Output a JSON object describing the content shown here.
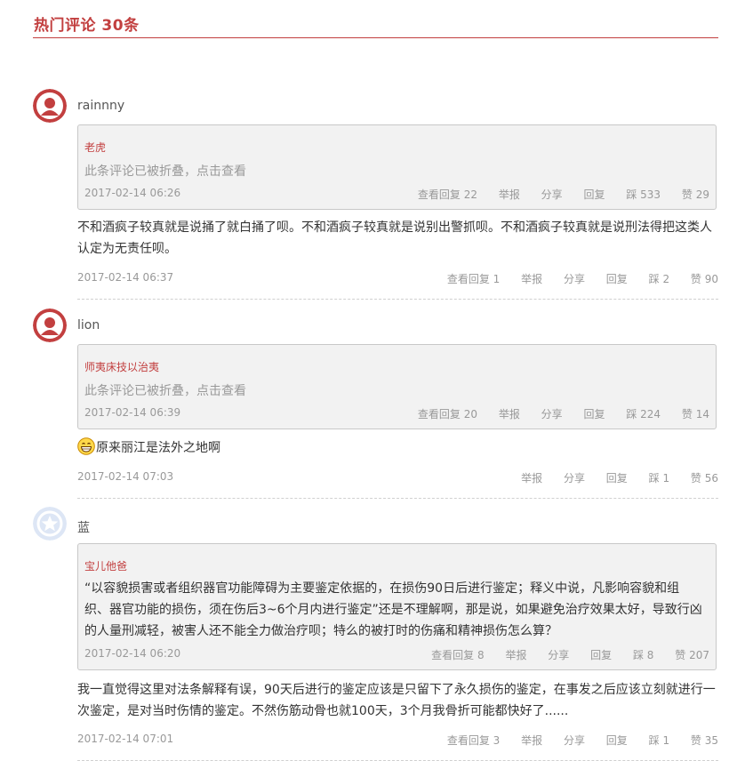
{
  "header": {
    "title": "热门评论 30条"
  },
  "comments": [
    {
      "user": "rainnny",
      "quote": {
        "user": "老虎",
        "folded": "此条评论已被折叠，点击查看",
        "time": "2017-02-14 06:26",
        "view_replies": "查看回复 22",
        "report": "举报",
        "share": "分享",
        "reply": "回复",
        "dislike": "踩 533",
        "like": "赞 29"
      },
      "text": "不和酒疯子较真就是说捅了就白捅了呗。不和酒疯子较真就是说别出警抓呗。不和酒疯子较真就是说刑法得把这类人认定为无责任呗。",
      "time": "2017-02-14 06:37",
      "view_replies": "查看回复 1",
      "report": "举报",
      "share": "分享",
      "reply": "回复",
      "dislike": "踩 2",
      "like": "赞 90"
    },
    {
      "user": "lion",
      "quote": {
        "user": "师夷床技以治夷",
        "folded": "此条评论已被折叠，点击查看",
        "time": "2017-02-14 06:39",
        "view_replies": "查看回复 20",
        "report": "举报",
        "share": "分享",
        "reply": "回复",
        "dislike": "踩 224",
        "like": "赞 14"
      },
      "text": "原来丽江是法外之地啊",
      "time": "2017-02-14 07:03",
      "report": "举报",
      "share": "分享",
      "reply": "回复",
      "dislike": "踩 1",
      "like": "赞 56"
    },
    {
      "user": "蓝",
      "quote": {
        "user": "宝儿他爸",
        "text": "“以容貌损害或者组织器官功能障碍为主要鉴定依据的，在损伤90日后进行鉴定；释义中说，凡影响容貌和组织、器官功能的损伤，须在伤后3~6个月内进行鉴定”还是不理解啊，那是说，如果避免治疗效果太好，导致行凶的人量刑减轻，被害人还不能全力做治疗呗；特么的被打时的伤痛和精神损伤怎么算？",
        "time": "2017-02-14 06:20",
        "view_replies": "查看回复 8",
        "report": "举报",
        "share": "分享",
        "reply": "回复",
        "dislike": "踩 8",
        "like": "赞 207"
      },
      "text": "我一直觉得这里对法条解释有误，90天后进行的鉴定应该是只留下了永久损伤的鉴定，在事发之后应该立刻就进行一次鉴定，是对当时伤情的鉴定。不然伤筋动骨也就100天，3个月我骨折可能都快好了......",
      "time": "2017-02-14 07:01",
      "view_replies": "查看回复 3",
      "report": "举报",
      "share": "分享",
      "reply": "回复",
      "dislike": "踩 1",
      "like": "赞 35"
    }
  ],
  "colors": {
    "accent": "#c23f3f",
    "muted": "#999999",
    "quote_bg": "#f2f2f2"
  },
  "icons": {
    "avatar_default": "user-silhouette-icon",
    "avatar_default2": "star-badge-icon",
    "emoji": "grinning-face-icon"
  }
}
